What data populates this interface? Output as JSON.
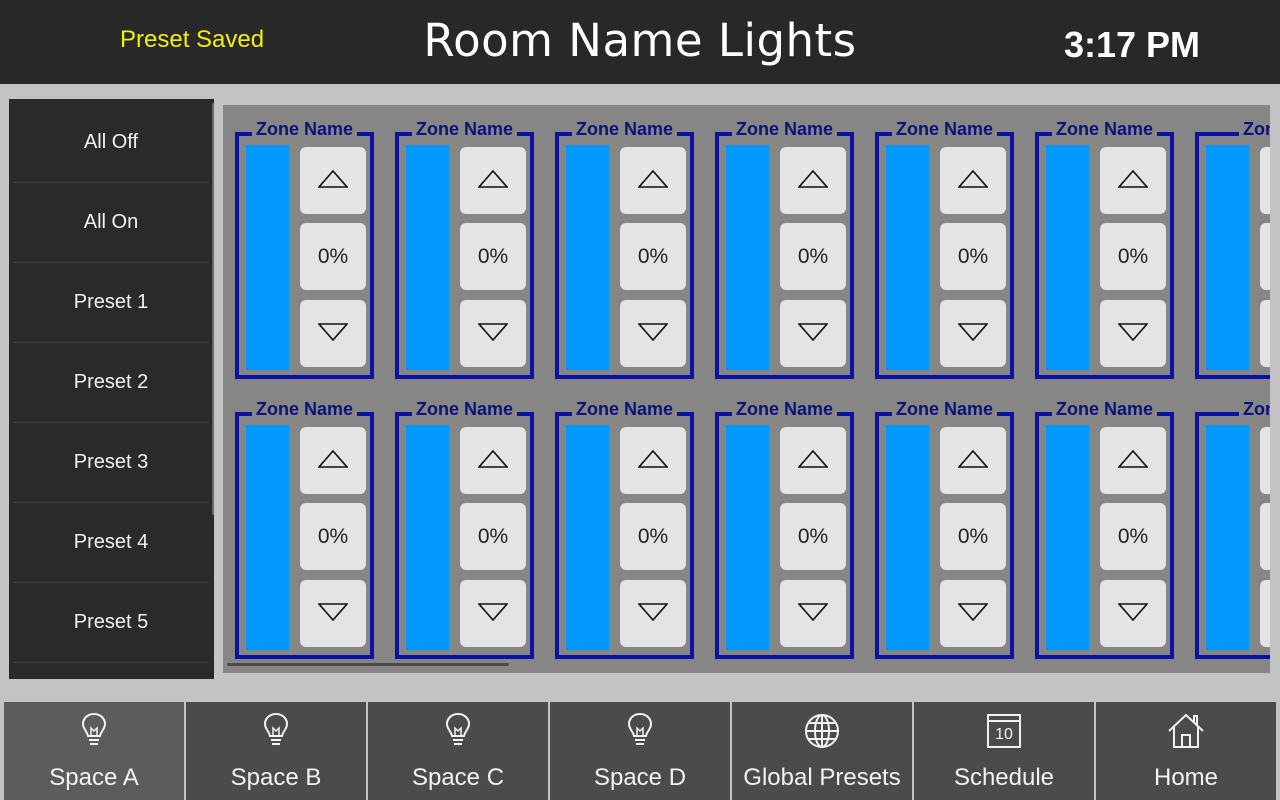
{
  "header": {
    "status": "Preset Saved",
    "title": "Room Name Lights",
    "time": "3:17 PM",
    "status_color": "#f3f000"
  },
  "sidebar": {
    "items": [
      {
        "label": "All Off"
      },
      {
        "label": "All On"
      },
      {
        "label": "Preset 1"
      },
      {
        "label": "Preset 2"
      },
      {
        "label": "Preset 3"
      },
      {
        "label": "Preset 4"
      },
      {
        "label": "Preset 5"
      }
    ]
  },
  "zones": {
    "rows": [
      [
        {
          "name": "Zone Name",
          "level": "0%"
        },
        {
          "name": "Zone Name",
          "level": "0%"
        },
        {
          "name": "Zone Name",
          "level": "0%"
        },
        {
          "name": "Zone Name",
          "level": "0%"
        },
        {
          "name": "Zone Name",
          "level": "0%"
        },
        {
          "name": "Zone Name",
          "level": "0%"
        },
        {
          "name": "Zone",
          "level": ""
        }
      ],
      [
        {
          "name": "Zone Name",
          "level": "0%"
        },
        {
          "name": "Zone Name",
          "level": "0%"
        },
        {
          "name": "Zone Name",
          "level": "0%"
        },
        {
          "name": "Zone Name",
          "level": "0%"
        },
        {
          "name": "Zone Name",
          "level": "0%"
        },
        {
          "name": "Zone Name",
          "level": "0%"
        },
        {
          "name": "Zone",
          "level": ""
        }
      ]
    ],
    "up_icon": "triangle-up-icon",
    "down_icon": "triangle-down-icon",
    "bar_color": "#0097ff",
    "frame_color": "#0b12a3"
  },
  "nav": {
    "items": [
      {
        "label": "Space A",
        "icon": "lightbulb-icon",
        "active": true
      },
      {
        "label": "Space B",
        "icon": "lightbulb-icon"
      },
      {
        "label": "Space C",
        "icon": "lightbulb-icon"
      },
      {
        "label": "Space D",
        "icon": "lightbulb-icon"
      },
      {
        "label": "Global Presets",
        "icon": "globe-icon"
      },
      {
        "label": "Schedule",
        "icon": "calendar-icon",
        "icon_text": "10"
      },
      {
        "label": "Home",
        "icon": "home-icon"
      }
    ]
  }
}
